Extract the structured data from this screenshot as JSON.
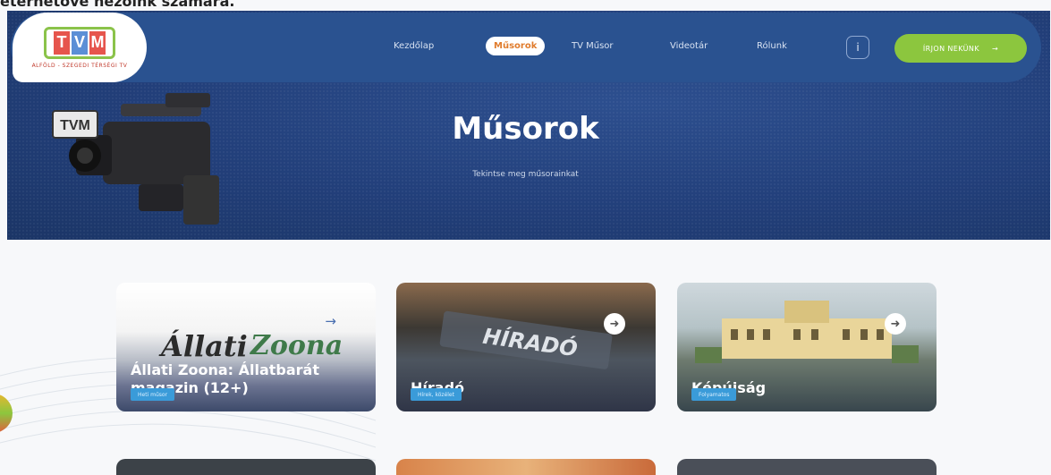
{
  "top_text": "eternetove nezoink szamara.",
  "logo": {
    "letters": [
      "T",
      "V",
      "M"
    ],
    "subtitle": "ALFÖLD - SZEGEDI TÉRSÉGI TV"
  },
  "nav": {
    "items": [
      {
        "label": "Kezdőlap"
      },
      {
        "label": "Műsorok"
      },
      {
        "label": "TV Műsor"
      },
      {
        "label": "Videotár"
      },
      {
        "label": "Rólunk"
      }
    ],
    "info_label": "i",
    "cta_label": "ÍRJON NEKÜNK",
    "cta_arrow": "→"
  },
  "hero": {
    "title": "Műsorok",
    "subtitle": "Tekintse meg műsorainkat"
  },
  "cards": [
    {
      "title_line1": "Állati Zoona: Állatbarát",
      "title_line2": "magazin (12+)",
      "badge": "Heti műsor",
      "arrow": "→"
    },
    {
      "title_line1": "Híradó",
      "title_line2": "",
      "badge": "Hírek, közélet",
      "arrow": "➜",
      "overlay_text": "HÍRADÓ"
    },
    {
      "title_line1": "Képújság",
      "title_line2": "",
      "badge": "Folyamatos",
      "arrow": "➜"
    }
  ],
  "colors": {
    "navbar": "#2a5290",
    "hero": "#223f7a",
    "accent_orange": "#e07c2d",
    "cta_green": "#8cc63e",
    "badge_blue": "#3a9bd9"
  }
}
